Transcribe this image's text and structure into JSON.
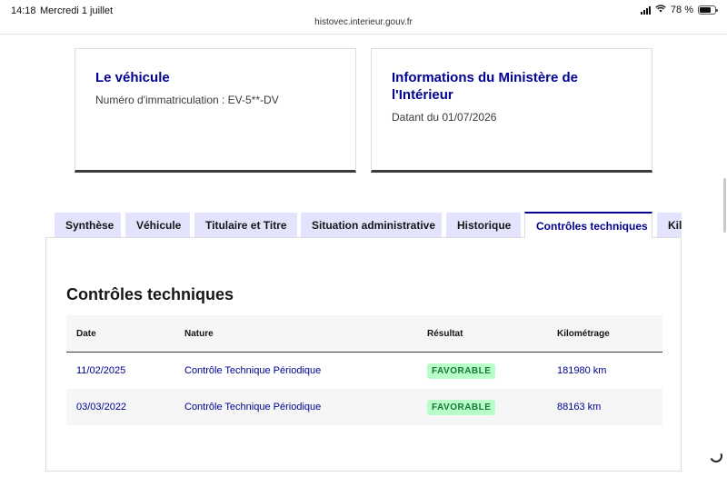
{
  "status_bar": {
    "time": "14:18",
    "date": "Mercredi 1 juillet",
    "battery": "78 %"
  },
  "browser": {
    "url": "histovec.interieur.gouv.fr"
  },
  "cards": {
    "vehicle": {
      "title": "Le véhicule",
      "text": "Numéro d'immatriculation : EV-5**-DV"
    },
    "ministry": {
      "title": "Informations du Ministère de l'Intérieur",
      "text": "Datant du 01/07/2026"
    }
  },
  "tabs": [
    {
      "label": "Synthèse",
      "active": false
    },
    {
      "label": "Véhicule",
      "active": false
    },
    {
      "label": "Titulaire et Titre",
      "active": false
    },
    {
      "label": "Situation administrative",
      "active": false
    },
    {
      "label": "Historique",
      "active": false
    },
    {
      "label": "Contrôles techniques",
      "active": true
    },
    {
      "label": "Kilo",
      "active": false
    }
  ],
  "section": {
    "title": "Contrôles techniques",
    "columns": [
      "Date",
      "Nature",
      "Résultat",
      "Kilométrage"
    ],
    "rows": [
      {
        "date": "11/02/2025",
        "nature": "Contrôle Technique Périodique",
        "result": "FAVORABLE",
        "km": "181980 km"
      },
      {
        "date": "03/03/2022",
        "nature": "Contrôle Technique Périodique",
        "result": "FAVORABLE",
        "km": "88163 km"
      }
    ]
  },
  "colors": {
    "primary": "#000091",
    "tab_bg": "#e3e3fd",
    "badge_bg": "#b8fec9",
    "badge_text": "#18753c"
  }
}
